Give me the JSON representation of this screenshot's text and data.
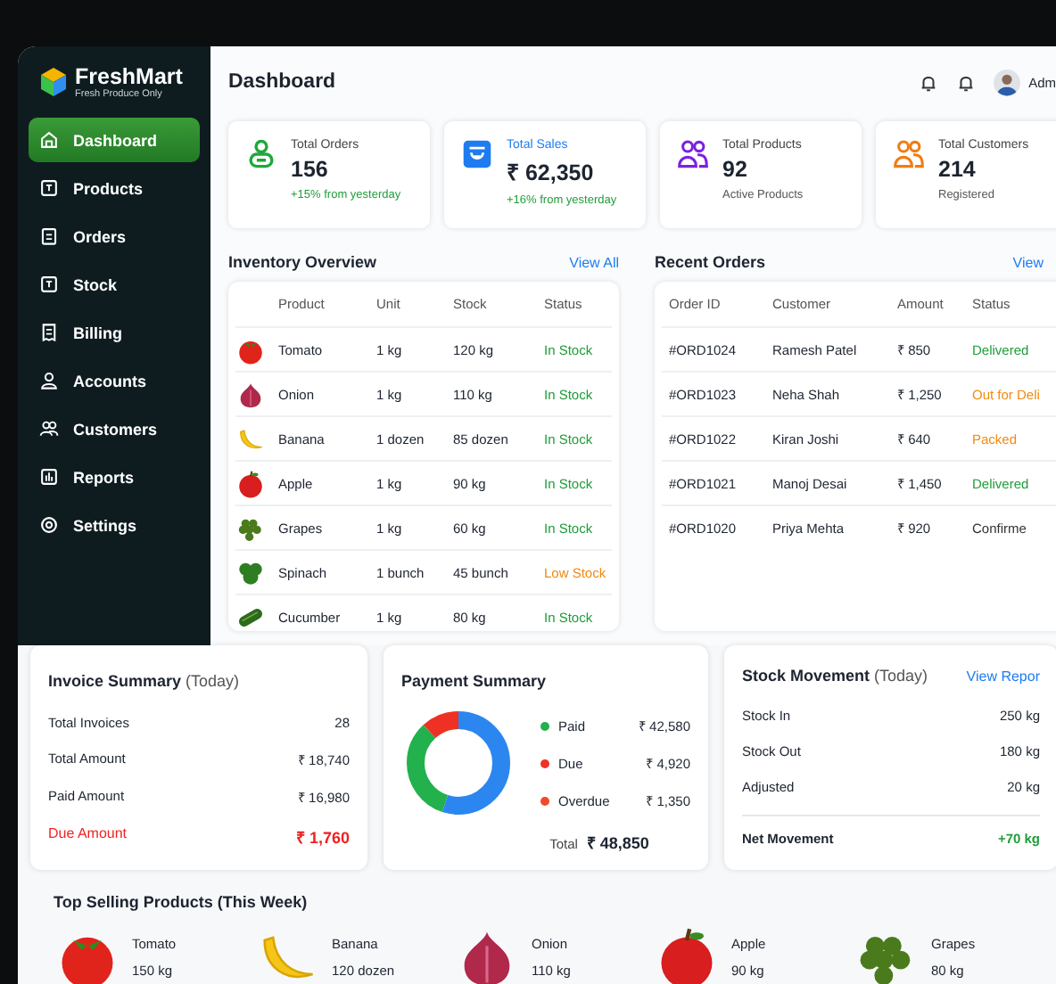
{
  "brand": {
    "name": "FreshMart",
    "tagline": "Fresh Produce Only"
  },
  "sidebar": {
    "items": [
      {
        "label": "Dashboard",
        "kind": "home",
        "selected": true
      },
      {
        "label": "Products",
        "kind": "box",
        "selected": false
      },
      {
        "label": "Orders",
        "kind": "clipboard",
        "selected": false
      },
      {
        "label": "Stock",
        "kind": "box",
        "selected": false
      },
      {
        "label": "Billing",
        "kind": "receipt",
        "selected": false
      },
      {
        "label": "Accounts",
        "kind": "person",
        "selected": false
      },
      {
        "label": "Customers",
        "kind": "people",
        "selected": false
      },
      {
        "label": "Reports",
        "kind": "chart",
        "selected": false
      },
      {
        "label": "Settings",
        "kind": "gear",
        "selected": false
      }
    ]
  },
  "header": {
    "title": "Dashboard",
    "user": "Adm"
  },
  "stats": [
    {
      "label": "Total Orders",
      "value": "156",
      "note": "+15% from yesterday",
      "positive": true,
      "highlighted": false,
      "kind": "person",
      "color": "#1fa83a"
    },
    {
      "label": "Total Sales",
      "value": "₹ 62,350",
      "note": "+16% from yesterday",
      "positive": true,
      "highlighted": true,
      "kind": "badge",
      "color": "#1f7cf0"
    },
    {
      "label": "Total Products",
      "value": "92",
      "note": "Active Products",
      "positive": false,
      "highlighted": false,
      "kind": "people",
      "color": "#7a22e0"
    },
    {
      "label": "Total Customers",
      "value": "214",
      "note": "Registered",
      "positive": false,
      "highlighted": false,
      "kind": "people",
      "color": "#f07d12"
    }
  ],
  "inventory": {
    "title": "Inventory Overview",
    "link": "View All",
    "columns": [
      "Product",
      "Unit",
      "Stock",
      "Status"
    ],
    "rows": [
      {
        "kind": "tomato",
        "product": "Tomato",
        "unit": "1 kg",
        "stock": "120 kg",
        "status": "In Stock",
        "color": "#1f9d3a"
      },
      {
        "kind": "onion",
        "product": "Onion",
        "unit": "1 kg",
        "stock": "110 kg",
        "status": "In Stock",
        "color": "#1f9d3a"
      },
      {
        "kind": "banana",
        "product": "Banana",
        "unit": "1 dozen",
        "stock": "85 dozen",
        "status": "In Stock",
        "color": "#1f9d3a"
      },
      {
        "kind": "apple",
        "product": "Apple",
        "unit": "1 kg",
        "stock": "90 kg",
        "status": "In Stock",
        "color": "#1f9d3a"
      },
      {
        "kind": "grapes",
        "product": "Grapes",
        "unit": "1 kg",
        "stock": "60 kg",
        "status": "In Stock",
        "color": "#1f9d3a"
      },
      {
        "kind": "spinach",
        "product": "Spinach",
        "unit": "1 bunch",
        "stock": "45 bunch",
        "status": "Low Stock",
        "color": "#f08a12"
      },
      {
        "kind": "cucumber",
        "product": "Cucumber",
        "unit": "1 kg",
        "stock": "80 kg",
        "status": "In Stock",
        "color": "#1f9d3a"
      }
    ]
  },
  "orders": {
    "title": "Recent Orders",
    "link": "View",
    "columns": [
      "Order ID",
      "Customer",
      "Amount",
      "Status"
    ],
    "rows": [
      {
        "id": "#ORD1024",
        "customer": "Ramesh Patel",
        "amount": "₹ 850",
        "status": "Delivered",
        "color": "#1f9d3a"
      },
      {
        "id": "#ORD1023",
        "customer": "Neha Shah",
        "amount": "₹ 1,250",
        "status": "Out for Deli",
        "color": "#f08a12"
      },
      {
        "id": "#ORD1022",
        "customer": "Kiran Joshi",
        "amount": "₹ 640",
        "status": "Packed",
        "color": "#f08a12"
      },
      {
        "id": "#ORD1021",
        "customer": "Manoj Desai",
        "amount": "₹ 1,450",
        "status": "Delivered",
        "color": "#1f9d3a"
      },
      {
        "id": "#ORD1020",
        "customer": "Priya Mehta",
        "amount": "₹ 920",
        "status": "Confirme",
        "color": "#333333"
      }
    ]
  },
  "invoice": {
    "title": "Invoice Summary",
    "subtitle": "(Today)",
    "rows": [
      {
        "label": "Total Invoices",
        "value": "28",
        "alert": false
      },
      {
        "label": "Total Amount",
        "value": "₹ 18,740",
        "alert": false
      },
      {
        "label": "Paid Amount",
        "value": "₹ 16,980",
        "alert": false
      },
      {
        "label": "Due Amount",
        "value": "₹ 1,760",
        "alert": true
      }
    ]
  },
  "payment": {
    "title": "Payment Summary",
    "legend": [
      {
        "label": "Paid",
        "value": "₹ 42,580",
        "color": "#22b14c"
      },
      {
        "label": "Due",
        "value": "₹ 4,920",
        "color": "#ee3124"
      },
      {
        "label": "Overdue",
        "value": "₹ 1,350",
        "color": "#f04a2a"
      }
    ],
    "total_label": "Total",
    "total": "₹ 48,850"
  },
  "stock_movement": {
    "title": "Stock Movement",
    "subtitle": "(Today)",
    "link": "View Repor",
    "rows": [
      {
        "label": "Stock In",
        "value": "250 kg",
        "kind": "entry"
      },
      {
        "label": "Stock Out",
        "value": "180 kg",
        "kind": "entry"
      },
      {
        "label": "Adjusted",
        "value": "20 kg",
        "kind": "entry"
      },
      {
        "label": "Net Movement",
        "value": "+70 kg",
        "kind": "net"
      }
    ]
  },
  "top_selling": {
    "title": "Top Selling Products (This Week)",
    "items": [
      {
        "kind": "tomato",
        "name": "Tomato",
        "amount": "150 kg"
      },
      {
        "kind": "banana",
        "name": "Banana",
        "amount": "120 dozen"
      },
      {
        "kind": "onion",
        "name": "Onion",
        "amount": "110 kg"
      },
      {
        "kind": "apple",
        "name": "Apple",
        "amount": "90 kg"
      },
      {
        "kind": "grapes",
        "name": "Grapes",
        "amount": "80 kg"
      }
    ]
  }
}
